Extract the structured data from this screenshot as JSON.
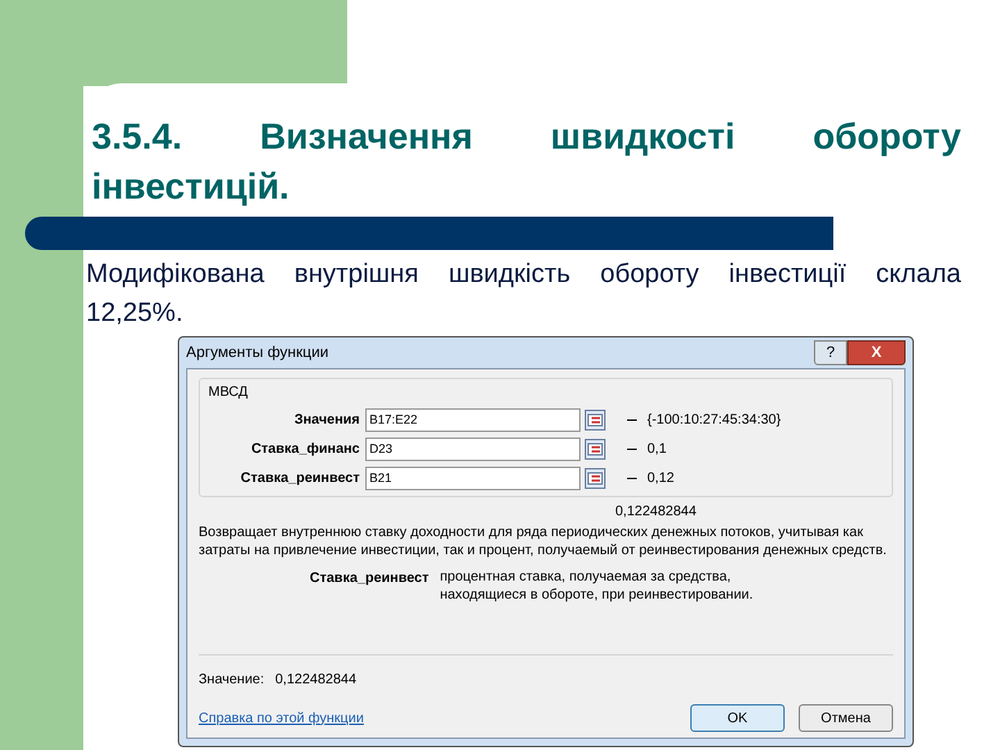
{
  "slide": {
    "title": "3.5.4. Визначення швидкості обороту інвестицій.",
    "body": "Модифікована внутрішня швидкість обороту інвестиції склала 12,25%."
  },
  "dialog": {
    "title": "Аргументы функции",
    "help_glyph": "?",
    "close_glyph": "X",
    "function_name": "МВСД",
    "arguments": [
      {
        "label": "Значения",
        "value": "B17:E22",
        "result": "{-100:10:27:45:34:30}"
      },
      {
        "label": "Ставка_финанс",
        "value": "D23",
        "result": "0,1"
      },
      {
        "label": "Ставка_реинвест",
        "value": "B21",
        "result": "0,12"
      }
    ],
    "formula_result": "0,122482844",
    "description": "Возвращает внутреннюю ставку доходности для ряда периодических денежных потоков, учитывая как затраты на привлечение инвестиции, так и процент, получаемый от реинвестирования денежных средств.",
    "argument_help": {
      "name": "Ставка_реинвест",
      "text": "процентная ставка, получаемая за средства, находящиеся в обороте, при реинвестировании."
    },
    "value_label": "Значение:",
    "value": "0,122482844",
    "help_link": "Справка по этой функции",
    "buttons": [
      "OK",
      "Отмена"
    ]
  }
}
